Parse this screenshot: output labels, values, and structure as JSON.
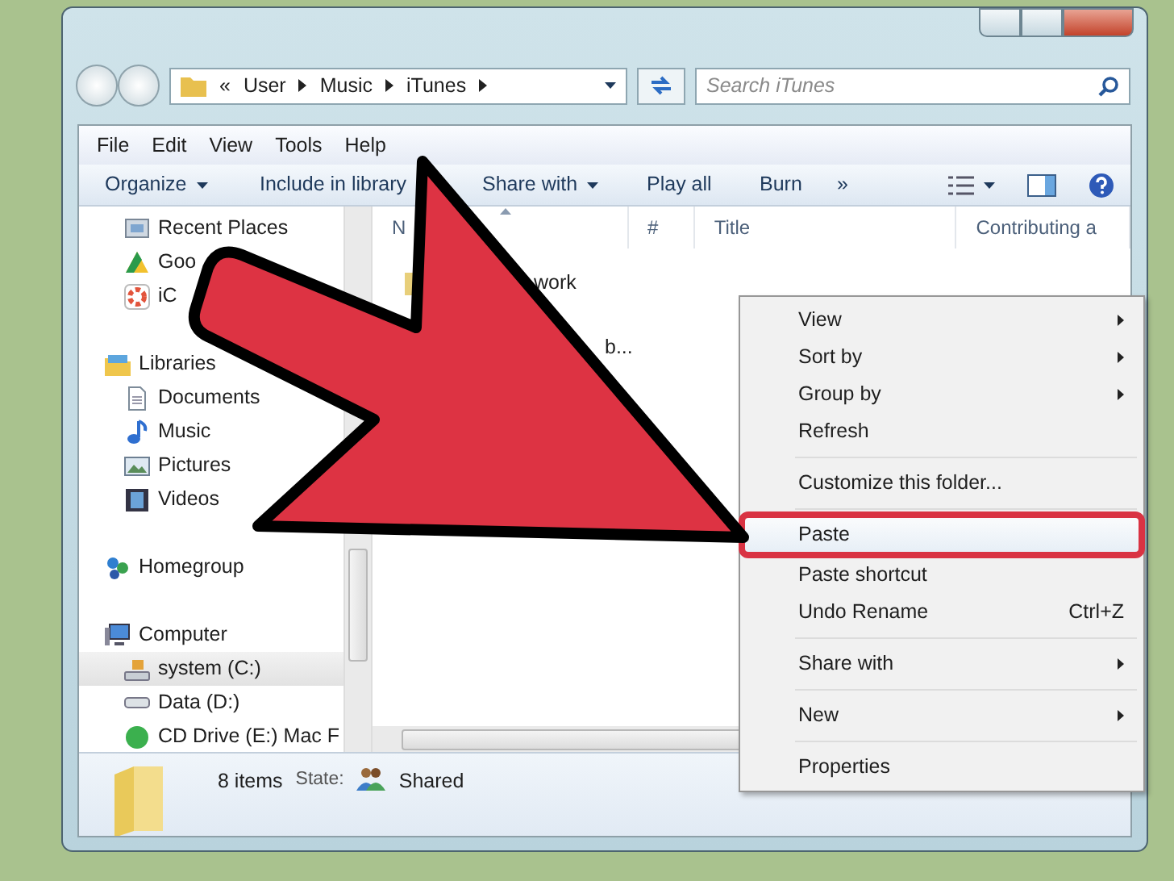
{
  "address_bar": {
    "overflow": "«",
    "crumbs": [
      "User",
      "Music",
      "iTunes"
    ]
  },
  "search": {
    "placeholder": "Search iTunes"
  },
  "menu_bar": [
    "File",
    "Edit",
    "View",
    "Tools",
    "Help"
  ],
  "toolbar": [
    {
      "label": "Organize",
      "dropdown": true
    },
    {
      "label": "Include in library",
      "dropdown": false
    },
    {
      "label": "Share with",
      "dropdown": true
    },
    {
      "label": "Play all",
      "dropdown": false
    },
    {
      "label": "Burn",
      "dropdown": false
    },
    {
      "label": "»",
      "dropdown": false
    }
  ],
  "nav_tree": [
    {
      "children": [
        {
          "kind": "recent",
          "label": "Recent Places",
          "selected": false
        },
        {
          "kind": "cloud",
          "label": "Goo",
          "selected": false
        },
        {
          "kind": "photos",
          "label": "iC",
          "selected": false
        }
      ]
    },
    {
      "kind": "library",
      "label": "Libraries",
      "selected": false,
      "children": [
        {
          "kind": "documents",
          "label": "Documents",
          "selected": false
        },
        {
          "kind": "music",
          "label": "Music",
          "selected": false
        },
        {
          "kind": "pictures",
          "label": "Pictures",
          "selected": false
        },
        {
          "kind": "videos",
          "label": "Videos",
          "selected": false
        }
      ]
    },
    {
      "kind": "homegroup",
      "label": "Homegroup",
      "selected": false
    },
    {
      "kind": "computer",
      "label": "Computer",
      "selected": false,
      "children": [
        {
          "kind": "system",
          "label": "system (C:)",
          "selected": true
        },
        {
          "kind": "drive",
          "label": "Data (D:)",
          "selected": false
        },
        {
          "kind": "disc",
          "label": "CD Drive (E:) Mac F",
          "selected": false
        }
      ]
    }
  ],
  "table": {
    "columns": [
      {
        "label": "N",
        "sorted": true
      },
      {
        "label": "#",
        "sorted": false
      },
      {
        "label": "Title",
        "sorted": false
      },
      {
        "label": "Contributing a",
        "sorted": false
      }
    ],
    "rows": [
      "work",
      "b..."
    ]
  },
  "context_menu": {
    "items": [
      {
        "kind": "item",
        "label": "View",
        "submenu": true,
        "selected": false
      },
      {
        "kind": "item",
        "label": "Sort by",
        "submenu": true,
        "selected": false
      },
      {
        "kind": "item",
        "label": "Group by",
        "submenu": true,
        "selected": false
      },
      {
        "kind": "item",
        "label": "Refresh",
        "submenu": false,
        "selected": false
      },
      {
        "kind": "separator"
      },
      {
        "kind": "item",
        "label": "Customize this folder...",
        "submenu": false,
        "selected": false
      },
      {
        "kind": "separator"
      },
      {
        "kind": "item",
        "label": "Paste",
        "submenu": false,
        "selected": true
      },
      {
        "kind": "item",
        "label": "Paste shortcut",
        "submenu": false,
        "selected": false
      },
      {
        "kind": "item",
        "label": "Undo Rename",
        "shortcut": "Ctrl+Z",
        "submenu": false,
        "selected": false
      },
      {
        "kind": "separator"
      },
      {
        "kind": "item",
        "label": "Share with",
        "submenu": true,
        "selected": false
      },
      {
        "kind": "separator"
      },
      {
        "kind": "item",
        "label": "New",
        "submenu": true,
        "selected": false
      },
      {
        "kind": "separator"
      },
      {
        "kind": "item",
        "label": "Properties",
        "submenu": false,
        "selected": false
      }
    ]
  },
  "status_bar": {
    "count": "8 items",
    "state_label": "State:",
    "state_value": "Shared"
  }
}
